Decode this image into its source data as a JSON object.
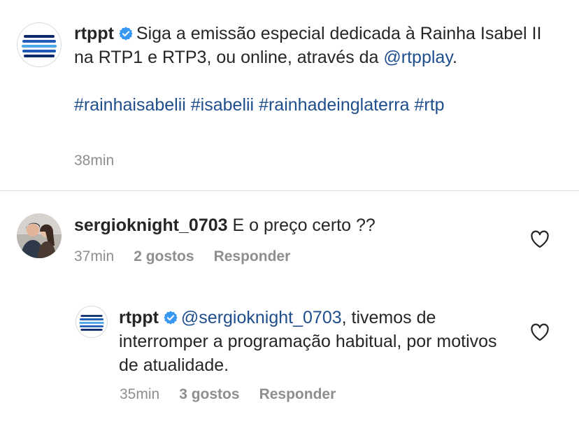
{
  "caption": {
    "username": "rtppt",
    "text_main": "Siga a emissão especial dedicada à Rainha Isabel II na RTP1 e RTP3, ou online, através da ",
    "mention": "@rtpplay",
    "text_end": ".",
    "hashtags": [
      "#rainhaisabelii",
      "#isabelii",
      "#rainhadeinglaterra",
      "#rtp"
    ],
    "time": "38min"
  },
  "comments": [
    {
      "username": "sergioknight_0703",
      "text": "E o preço certo ??",
      "time": "37min",
      "likes": "2 gostos",
      "reply_label": "Responder"
    },
    {
      "username": "rtppt",
      "mention": "@sergioknight_0703",
      "text": ", tivemos de interromper a programação habitual, por motivos de atualidade.",
      "time": "35min",
      "likes": "3 gostos",
      "reply_label": "Responder"
    }
  ],
  "icons": {
    "verified": "verified-badge-icon",
    "like": "heart-icon"
  },
  "colors": {
    "link": "#1f4e8c",
    "verified": "#3897f0",
    "meta": "#8e8e8e",
    "logo_dark": "#0b2a6b",
    "logo_light": "#4aa8e8"
  }
}
